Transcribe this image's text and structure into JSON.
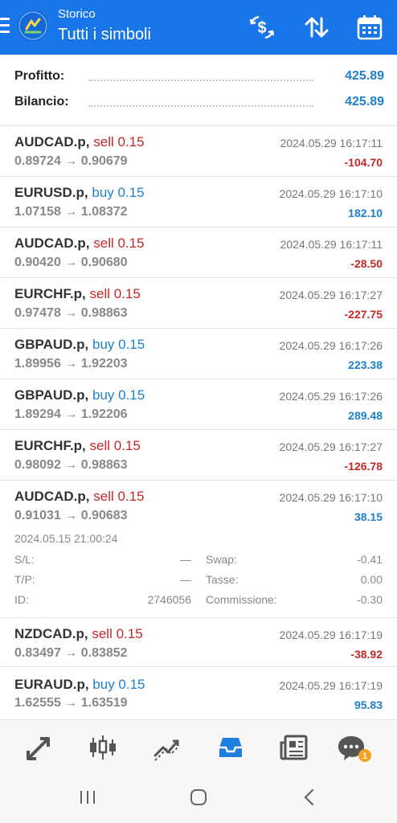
{
  "header": {
    "subtitle": "Storico",
    "title": "Tutti i simboli",
    "icons": [
      "menu-icon",
      "app-logo",
      "currency-exchange-icon",
      "sort-icon",
      "calendar-icon"
    ]
  },
  "summary": {
    "profit_label": "Profitto:",
    "profit_value": "425.89",
    "balance_label": "Bilancio:",
    "balance_value": "425.89"
  },
  "colors": {
    "header": "#1976e8",
    "sell": "#c62828",
    "buy": "#1f7fc9",
    "badge": "#f4a11d"
  },
  "trades": [
    {
      "symbol": "AUDCAD.p,",
      "dir": "sell 0.15",
      "prices": "0.89724 → 0.90679",
      "time": "2024.05.29 16:17:11",
      "profit": "-104.70"
    },
    {
      "symbol": "EURUSD.p,",
      "dir": "buy 0.15",
      "prices": "1.07158 → 1.08372",
      "time": "2024.05.29 16:17:10",
      "profit": "182.10"
    },
    {
      "symbol": "AUDCAD.p,",
      "dir": "sell 0.15",
      "prices": "0.90420 → 0.90680",
      "time": "2024.05.29 16:17:11",
      "profit": "-28.50"
    },
    {
      "symbol": "EURCHF.p,",
      "dir": "sell 0.15",
      "prices": "0.97478 → 0.98863",
      "time": "2024.05.29 16:17:27",
      "profit": "-227.75"
    },
    {
      "symbol": "GBPAUD.p,",
      "dir": "buy 0.15",
      "prices": "1.89956 → 1.92203",
      "time": "2024.05.29 16:17:26",
      "profit": "223.38"
    },
    {
      "symbol": "GBPAUD.p,",
      "dir": "buy 0.15",
      "prices": "1.89294 → 1.92206",
      "time": "2024.05.29 16:17:26",
      "profit": "289.48"
    },
    {
      "symbol": "EURCHF.p,",
      "dir": "sell 0.15",
      "prices": "0.98092 → 0.98863",
      "time": "2024.05.29 16:17:27",
      "profit": "-126.78"
    },
    {
      "symbol": "AUDCAD.p,",
      "dir": "sell 0.15",
      "prices": "0.91031 → 0.90683",
      "time": "2024.05.29 16:17:10",
      "profit": "38.15",
      "details": {
        "open_time": "2024.05.15 21:00:24",
        "sl_label": "S/L:",
        "sl_value": "—",
        "tp_label": "T/P:",
        "tp_value": "—",
        "id_label": "ID:",
        "id_value": "2746056",
        "swap_label": "Swap:",
        "swap_value": "-0.41",
        "tax_label": "Tasse:",
        "tax_value": "0.00",
        "commission_label": "Commissione:",
        "commission_value": "-0.30"
      }
    },
    {
      "symbol": "NZDCAD.p,",
      "dir": "sell 0.15",
      "prices": "0.83497 → 0.83852",
      "time": "2024.05.29 16:17:19",
      "profit": "-38.92"
    },
    {
      "symbol": "EURAUD.p,",
      "dir": "buy 0.15",
      "prices": "1.62555 → 1.63519",
      "time": "2024.05.29 16:17:19",
      "profit": "95.83"
    }
  ],
  "bottom_nav": {
    "items": [
      "quotes-icon",
      "chart-icon",
      "trade-icon",
      "history-icon",
      "news-icon",
      "messages-icon"
    ],
    "messages_badge": "1"
  },
  "system_nav": [
    "recent-apps-icon",
    "home-icon",
    "back-icon"
  ]
}
